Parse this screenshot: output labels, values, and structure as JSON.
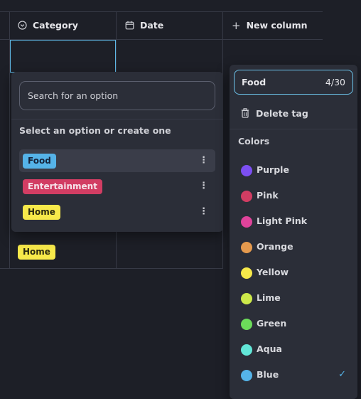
{
  "table": {
    "columns": [
      {
        "label": "Category",
        "icon": "select-icon"
      },
      {
        "label": "Date",
        "icon": "calendar-icon"
      },
      {
        "label": "New column",
        "icon": "plus-icon"
      }
    ],
    "visible_cell_tag": {
      "label": "Home",
      "color": "#f7e94a"
    }
  },
  "dropdown": {
    "search_placeholder": "Search for an option",
    "hint": "Select an option or create one",
    "options": [
      {
        "label": "Food",
        "color": "#55b3e8",
        "text_color": "#15233a",
        "selected": true
      },
      {
        "label": "Entertainment",
        "color": "#d23d63",
        "text_color": "#f6e3ea",
        "selected": false
      },
      {
        "label": "Home",
        "color": "#f7e94a",
        "text_color": "#2b2a10",
        "selected": false
      }
    ]
  },
  "tag_editor": {
    "name_value": "Food",
    "char_count": "4/30",
    "delete_label": "Delete tag",
    "colors_heading": "Colors",
    "colors": [
      {
        "label": "Purple",
        "color": "#7c4ff2"
      },
      {
        "label": "Pink",
        "color": "#d23d63"
      },
      {
        "label": "Light Pink",
        "color": "#e0439b"
      },
      {
        "label": "Orange",
        "color": "#e59a4e"
      },
      {
        "label": "Yellow",
        "color": "#f7e94a"
      },
      {
        "label": "Lime",
        "color": "#cde94a"
      },
      {
        "label": "Green",
        "color": "#6cdc5a"
      },
      {
        "label": "Aqua",
        "color": "#62e6d8"
      },
      {
        "label": "Blue",
        "color": "#55b3e8",
        "selected": true
      }
    ],
    "selected_check": "✓"
  }
}
